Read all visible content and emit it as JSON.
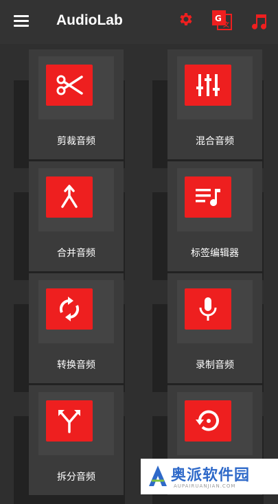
{
  "app": {
    "title": "AudioLab"
  },
  "toolbar_icons": [
    "settings-icon",
    "translate-icon",
    "music-note-icon"
  ],
  "colors": {
    "accent": "#ee1f1f",
    "background": "#2f2f2f",
    "appbar": "#333333"
  },
  "tools": [
    {
      "label": "剪裁音频",
      "icon": "scissors-icon"
    },
    {
      "label": "混合音频",
      "icon": "equalizer-icon"
    },
    {
      "label": "合并音频",
      "icon": "merge-icon"
    },
    {
      "label": "标签编辑器",
      "icon": "playlist-music-icon"
    },
    {
      "label": "转换音频",
      "icon": "convert-icon"
    },
    {
      "label": "录制音频",
      "icon": "microphone-icon"
    },
    {
      "label": "拆分音频",
      "icon": "split-icon"
    },
    {
      "label": "",
      "icon": "restore-icon"
    }
  ],
  "watermark": {
    "text": "奥派软件园",
    "sub": "AUPAIRUANJIAN.COM"
  }
}
